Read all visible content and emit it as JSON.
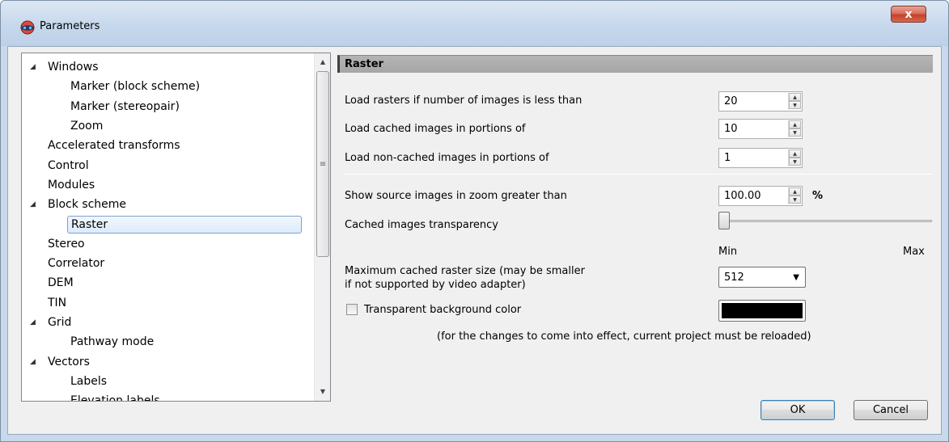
{
  "window": {
    "title": "Parameters",
    "close_label": "x"
  },
  "tree": {
    "items": [
      {
        "label": "Windows",
        "expanded": true,
        "level": 0
      },
      {
        "label": "Marker (block scheme)",
        "level": 1
      },
      {
        "label": "Marker (stereopair)",
        "level": 1
      },
      {
        "label": "Zoom",
        "level": 1
      },
      {
        "label": "Accelerated transforms",
        "level": 0
      },
      {
        "label": "Control",
        "level": 0
      },
      {
        "label": "Modules",
        "level": 0
      },
      {
        "label": "Block scheme",
        "expanded": true,
        "level": 0
      },
      {
        "label": "Raster",
        "level": 1,
        "selected": true
      },
      {
        "label": "Stereo",
        "level": 0
      },
      {
        "label": "Correlator",
        "level": 0
      },
      {
        "label": "DEM",
        "level": 0
      },
      {
        "label": "TIN",
        "level": 0
      },
      {
        "label": "Grid",
        "expanded": true,
        "level": 0
      },
      {
        "label": "Pathway mode",
        "level": 1
      },
      {
        "label": "Vectors",
        "expanded": true,
        "level": 0
      },
      {
        "label": "Labels",
        "level": 1
      },
      {
        "label": "Elevation labels",
        "level": 1
      }
    ]
  },
  "raster": {
    "header": "Raster",
    "load_rasters_label": "Load rasters if number of images is less than",
    "load_rasters_value": "20",
    "cached_portions_label": "Load cached images in portions of",
    "cached_portions_value": "10",
    "noncached_portions_label": "Load non-cached images in portions of",
    "noncached_portions_value": "1",
    "zoom_label": "Show source images in zoom greater than",
    "zoom_value": "100.00",
    "zoom_unit": "%",
    "transparency_label": "Cached images transparency",
    "transparency_level": 0,
    "slider_min": "Min",
    "slider_max": "Max",
    "max_size_label_line1": "Maximum cached raster size (may be smaller",
    "max_size_label_line2": "if not supported by video adapter)",
    "max_size_value": "512",
    "transparent_bg_label": "Transparent background color",
    "transparent_bg_checked": false,
    "bg_color": "#000000",
    "note": "(for the changes to come into effect, current project must be reloaded)"
  },
  "buttons": {
    "ok": "OK",
    "cancel": "Cancel"
  }
}
